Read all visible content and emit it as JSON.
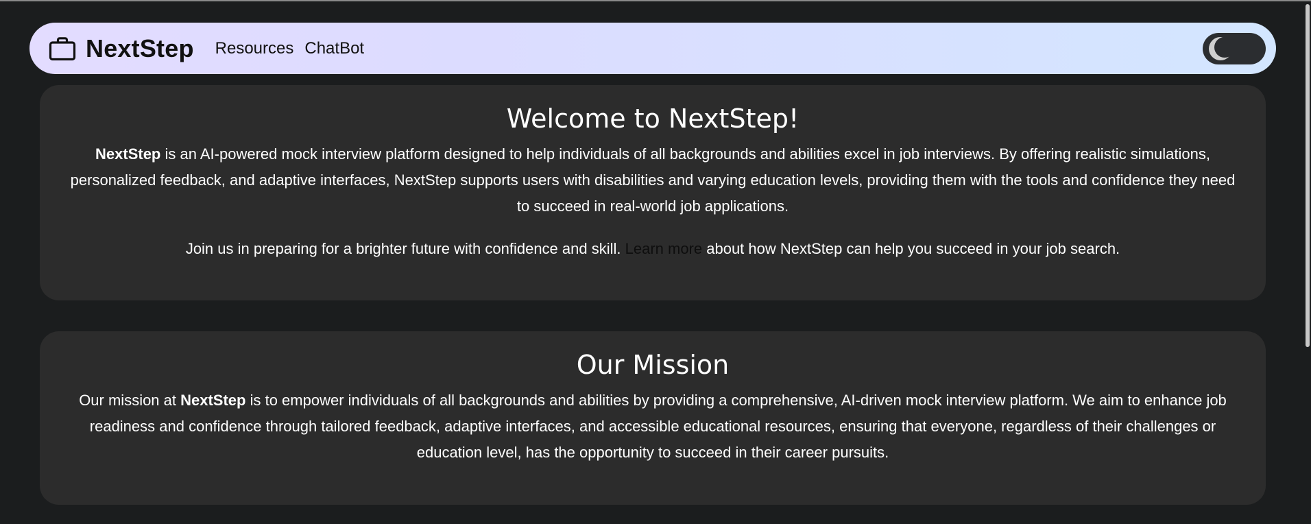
{
  "navbar": {
    "brand": "NextStep",
    "brand_icon": "briefcase-icon",
    "links": [
      {
        "label": "Resources"
      },
      {
        "label": "ChatBot"
      }
    ],
    "theme_toggle_icon": "moon-icon"
  },
  "welcome": {
    "title": "Welcome to NextStep!",
    "intro_bold": "NextStep",
    "intro_rest": " is an AI-powered mock interview platform designed to help individuals of all backgrounds and abilities excel in job interviews. By offering realistic simulations, personalized feedback, and adaptive interfaces, NextStep supports users with disabilities and varying education levels, providing them with the tools and confidence they need to succeed in real-world job applications.",
    "join_before": "Join us in preparing for a brighter future with confidence and skill. ",
    "learn_more": "Learn more",
    "join_after": " about how NextStep can help you succeed in your job search."
  },
  "mission": {
    "title": "Our Mission",
    "text_before": "Our mission at ",
    "text_bold": "NextStep",
    "text_after": " is to empower individuals of all backgrounds and abilities by providing a comprehensive, AI-driven mock interview platform. We aim to enhance job readiness and confidence through tailored feedback, adaptive interfaces, and accessible educational resources, ensuring that everyone, regardless of their challenges or education level, has the opportunity to succeed in their career pursuits."
  },
  "colors": {
    "background": "#1b1d1e",
    "card": "#2c2c2c",
    "navbar_gradient_start": "#e3dcff",
    "navbar_gradient_end": "#d3e6ff",
    "toggle": "#2b2d30"
  }
}
